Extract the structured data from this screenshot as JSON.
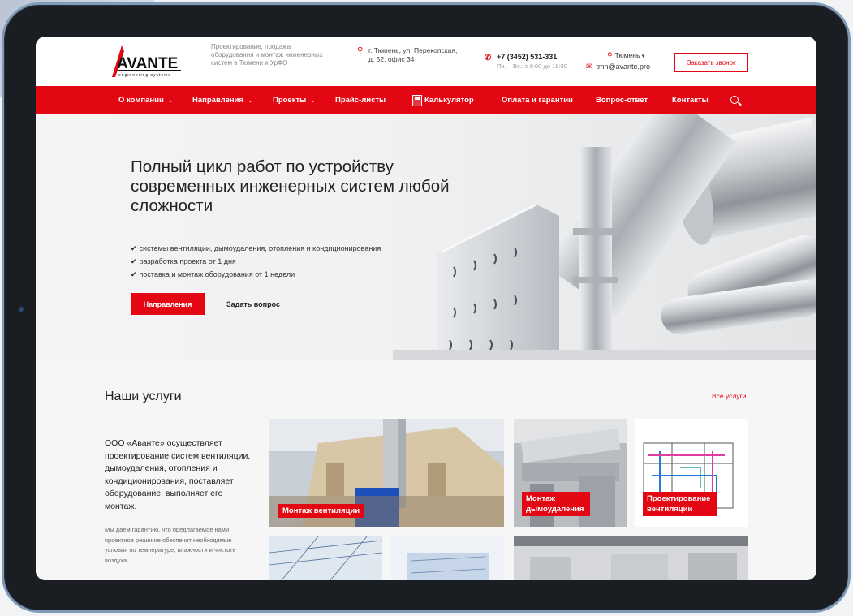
{
  "header": {
    "tagline": "Проектирование, продажа оборудования и монтаж инженерных систем в Тюмени и УрФО",
    "address": "г. Тюмень, ул. Перекопская, д. 52, офис 34",
    "phone": "+7 (3452) 531-331",
    "hours": "Пн. – Вс.: с 9:00 до 18:00",
    "city": "Тюмень",
    "email": "tmn@avante.pro",
    "call_button": "Заказать звонок",
    "logo_text": "AVANTE",
    "logo_sub": "engineering systems"
  },
  "nav": {
    "items": [
      {
        "label": "О компании",
        "chevron": "⌄"
      },
      {
        "label": "Направления",
        "chevron": "⌄"
      },
      {
        "label": "Проекты",
        "chevron": "⌄"
      },
      {
        "label": "Прайс-листы"
      },
      {
        "label": "Калькулятор"
      },
      {
        "label": "Оплата и гарантии"
      },
      {
        "label": "Вопрос-ответ"
      },
      {
        "label": "Контакты"
      }
    ]
  },
  "hero": {
    "title": "Полный цикл работ по устройству современных инженерных систем любой сложности",
    "checks": [
      "системы вентиляции, дымоудаления, отопления и кондиционирования",
      "разработка проекта от 1 дня",
      "поставка и монтаж оборудования от 1 недели"
    ],
    "primary_button": "Направления",
    "secondary_button": "Задать вопрос"
  },
  "services": {
    "title": "Наши услуги",
    "all_link": "Все услуги",
    "description": "ООО «Аванте» осуществляет проектирование систем вентиляции, дымоудаления, отопления и кондиционирования, поставляет оборудование, выполняет его монтаж.",
    "note": "Мы даем гарантию, что предлагаемое нами проектное решение обеспечит необходимые условия по температуре, влажности и чистоте воздуха.",
    "tiles": [
      {
        "label": "Монтаж вентиляции"
      },
      {
        "label": "Монтаж дымоудаления"
      },
      {
        "label": "Проектирование вентиляции"
      }
    ]
  },
  "colors": {
    "accent": "#e30613",
    "text": "#222222"
  }
}
